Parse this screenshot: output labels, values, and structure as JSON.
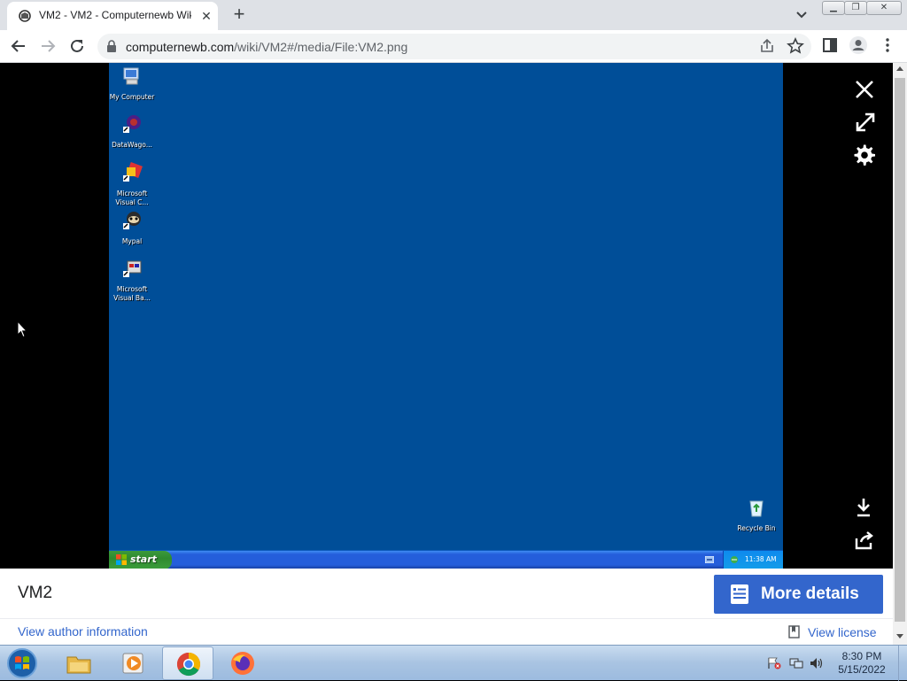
{
  "browser": {
    "tab_title": "VM2 - VM2 - Computernewb Wiki",
    "url_host": "computernewb.com",
    "url_path": "/wiki/VM2#/media/File:VM2.png"
  },
  "vm_desktop": {
    "icons": [
      {
        "label": "My Computer"
      },
      {
        "label": "DataWago..."
      },
      {
        "label": "Microsoft Visual C..."
      },
      {
        "label": "Mypal"
      },
      {
        "label": "Microsoft Visual Ba..."
      }
    ],
    "recycle_bin_label": "Recycle Bin",
    "start_label": "start",
    "clock": "11:38 AM",
    "background_color": "#004e98"
  },
  "media_viewer": {
    "file_title": "VM2",
    "more_details_label": "More details",
    "author_link": "View author information",
    "license_link": "View license",
    "accent_color": "#3366cc"
  },
  "taskbar": {
    "apps": [
      {
        "icon": "file-explorer-icon",
        "active": false
      },
      {
        "icon": "media-player-icon",
        "active": false
      },
      {
        "icon": "chrome-icon",
        "active": true
      },
      {
        "icon": "firefox-icon",
        "active": false
      }
    ],
    "time": "8:30 PM",
    "date": "5/15/2022"
  }
}
